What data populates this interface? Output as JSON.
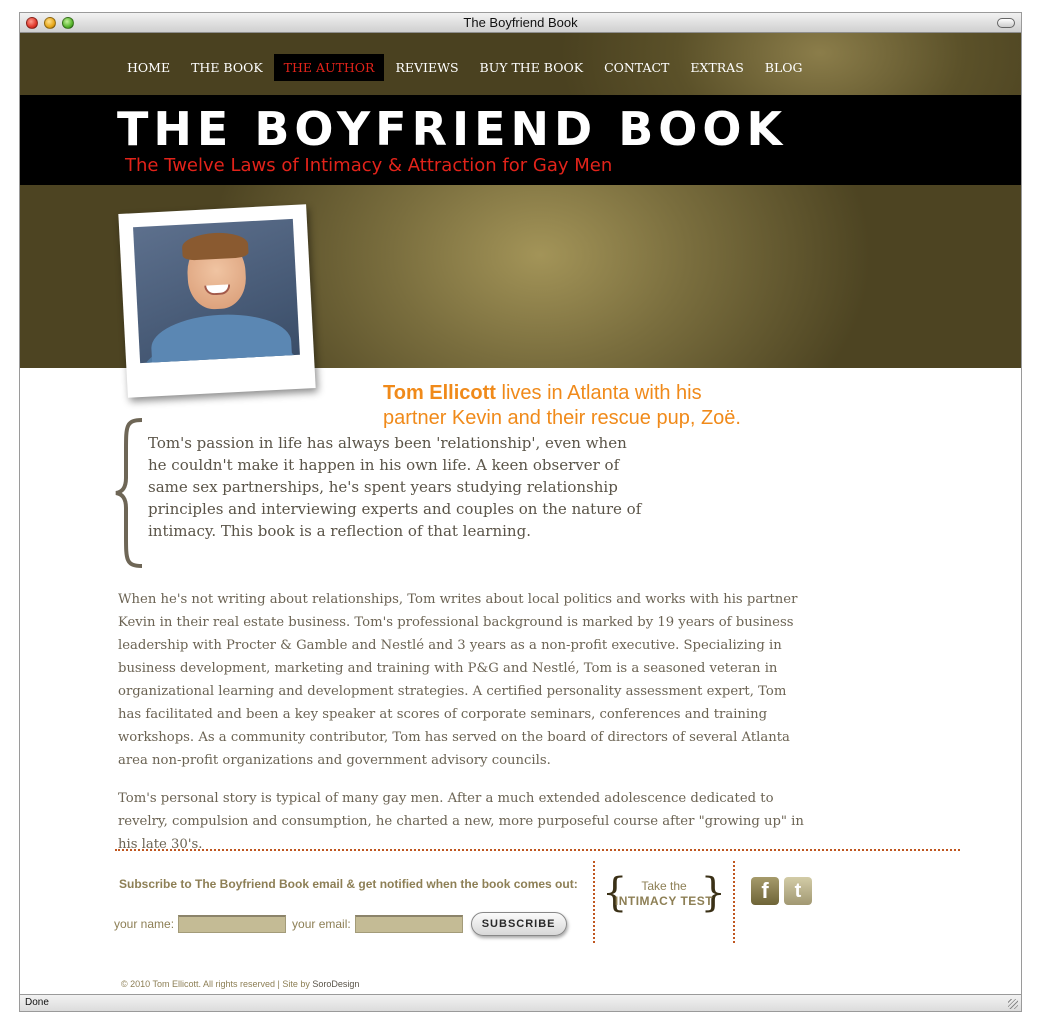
{
  "window": {
    "title": "The Boyfriend Book",
    "status": "Done"
  },
  "nav": [
    {
      "label": "HOME"
    },
    {
      "label": "THE BOOK"
    },
    {
      "label": "THE AUTHOR",
      "active": true
    },
    {
      "label": "REVIEWS"
    },
    {
      "label": "BUY THE BOOK"
    },
    {
      "label": "CONTACT"
    },
    {
      "label": "EXTRAS"
    },
    {
      "label": "BLOG"
    }
  ],
  "banner": {
    "title": "THE BOYFRIEND BOOK",
    "tagline": "The Twelve Laws of Intimacy & Attraction for Gay Men"
  },
  "hero": {
    "name": "Tom Ellicott",
    "text": " lives in Atlanta with his partner Kevin and their rescue pup, Zoë."
  },
  "quote": "Tom's passion in life has always been 'relationship', even when he couldn't make it happen in his own life. A keen observer of same sex partnerships, he's spent years studying relationship principles and interviewing experts and couples on the nature of intimacy. This book is a reflection of that learning.",
  "body": {
    "p1": "When he's not writing about relationships, Tom writes about local politics and works with his partner Kevin in their real estate business. Tom's professional background is marked by 19 years of business leadership with Procter & Gamble and Nestlé and 3 years as a non-profit executive. Specializing in business development, marketing and training with P&G and Nestlé, Tom is a seasoned veteran in organizational learning and development strategies. A certified personality assessment expert, Tom has facilitated and been a key speaker at scores of corporate seminars, conferences and training workshops. As a community contributor, Tom has served on the board of directors of several Atlanta area non-profit organizations and government advisory councils.",
    "p2": "Tom's personal story is typical of many gay men. After a much extended adolescence dedicated to revelry, compulsion and consumption, he charted a new, more purposeful course after \"growing up\" in his late 30's."
  },
  "subscribe": {
    "text": "Subscribe to The Boyfriend Book email & get notified when the book comes out:",
    "name_label": "your name:",
    "email_label": "your email:",
    "button": "SUBSCRIBE"
  },
  "test": {
    "line1": "Take the",
    "line2": "INTIMACY TEST"
  },
  "social": {
    "facebook_icon": "facebook-icon",
    "twitter_icon": "twitter-icon",
    "facebook_glyph": "f",
    "twitter_glyph": "t"
  },
  "footer": {
    "text": "© 2010 Tom Ellicott. All rights reserved | Site by ",
    "credit": "SoroDesign"
  }
}
